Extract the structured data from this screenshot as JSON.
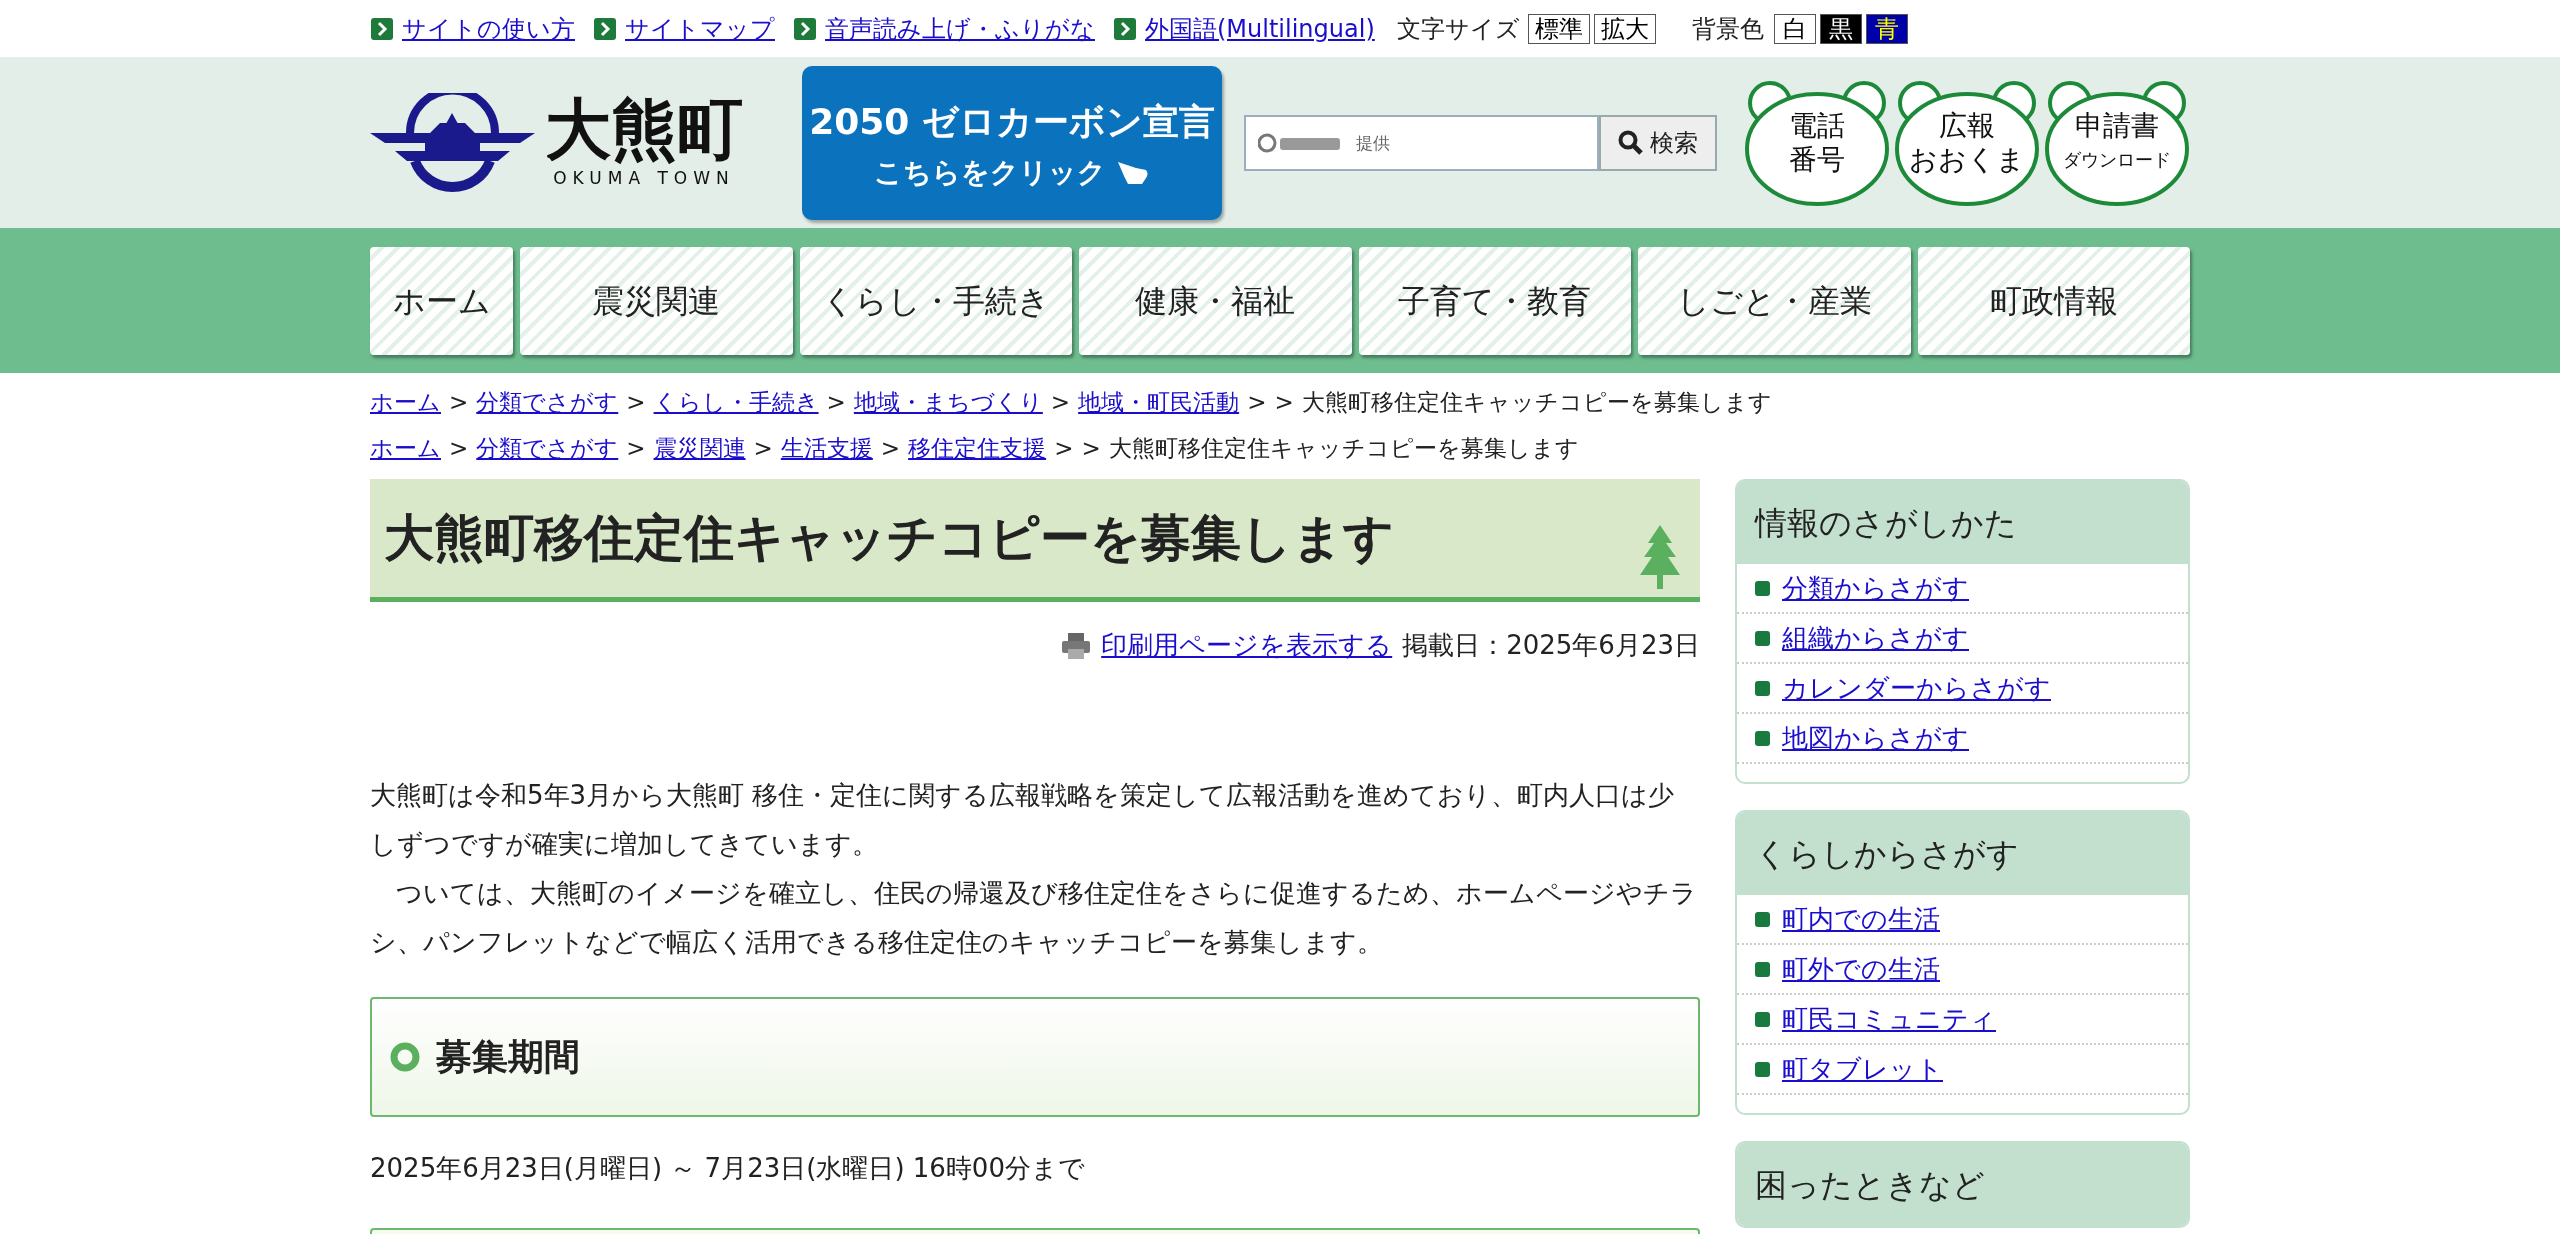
{
  "utility_bar": {
    "links": [
      {
        "label": "サイトの使い方"
      },
      {
        "label": "サイトマップ"
      },
      {
        "label": "音声読み上げ・ふりがな"
      },
      {
        "label": "外国語(Multilingual)"
      }
    ],
    "font_size": {
      "label": "文字サイズ",
      "options": [
        {
          "label": "標準",
          "kind": "plain"
        },
        {
          "label": "拡大",
          "kind": "plain"
        }
      ]
    },
    "background": {
      "label": "背景色",
      "options": [
        {
          "label": "白",
          "kind": "white"
        },
        {
          "label": "黒",
          "kind": "black"
        },
        {
          "label": "青",
          "kind": "blue"
        }
      ]
    }
  },
  "header": {
    "logo": {
      "name": "大熊町",
      "subtitle": "OKUMA TOWN"
    },
    "banner": {
      "title": "2050 ゼロカーボン宣言",
      "action": "こちらをクリック"
    },
    "search": {
      "placeholder": "提供",
      "button": "検索"
    },
    "quick_links": [
      {
        "lines": [
          "電話",
          "番号"
        ],
        "kind": "large"
      },
      {
        "lines": [
          "広報",
          "おおくま"
        ],
        "kind": "large"
      },
      {
        "lines": [
          "申請書",
          "ダウンロード"
        ],
        "kind": "small"
      }
    ]
  },
  "nav": [
    {
      "label": "ホーム"
    },
    {
      "label": "震災関連"
    },
    {
      "label": "くらし・手続き"
    },
    {
      "label": "健康・福祉"
    },
    {
      "label": "子育て・教育"
    },
    {
      "label": "しごと・産業"
    },
    {
      "label": "町政情報"
    }
  ],
  "breadcrumbs": [
    {
      "links": [
        "ホーム",
        "分類でさがす",
        "くらし・手続き",
        "地域・まちづくり",
        "地域・町民活動"
      ],
      "separator": ">",
      "current": "大熊町移住定住キャッチコピーを募集します"
    },
    {
      "links": [
        "ホーム",
        "分類でさがす",
        "震災関連",
        "生活支援",
        "移住定住支援"
      ],
      "separator": ">",
      "current": "大熊町移住定住キャッチコピーを募集します"
    }
  ],
  "page": {
    "title": "大熊町移住定住キャッチコピーを募集します",
    "print_link": "印刷用ページを表示する",
    "posted": "掲載日：2025年6月23日",
    "paragraphs": [
      "大熊町は令和5年3月から大熊町 移住・定住に関する広報戦略を策定して広報活動を進めており、町内人口は少しずつですが確実に増加してきています。",
      "　ついては、大熊町のイメージを確立し、住民の帰還及び移住定住をさらに促進するため、ホームページやチラシ、パンフレットなどで幅広く活用できる移住定住のキャッチコピーを募集します。"
    ],
    "sections": [
      {
        "heading": "募集期間",
        "body": "2025年6月23日(月曜日) ～ 7月23日(水曜日) 16時00分まで"
      }
    ]
  },
  "sidebar": [
    {
      "title": "情報のさがしかた",
      "items": [
        "分類からさがす",
        "組織からさがす",
        "カレンダーからさがす",
        "地図からさがす"
      ]
    },
    {
      "title": "くらしからさがす",
      "items": [
        "町内での生活",
        "町外での生活",
        "町民コミュニティ",
        "町タブレット"
      ]
    },
    {
      "title": "困ったときなど"
    }
  ]
}
